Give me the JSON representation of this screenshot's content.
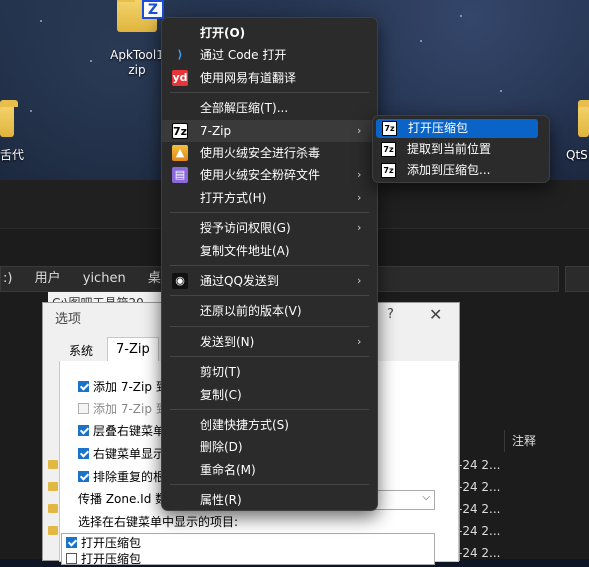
{
  "desktop": {
    "items": [
      {
        "label": "ApkTool1",
        "label2": "zip"
      },
      {
        "label": "舌代"
      },
      {
        "label": "QtS"
      }
    ]
  },
  "explorer": {
    "breadcrumb": [
      ":)",
      "用户",
      "yichen",
      "桌面"
    ],
    "window_title": "C:\\图吧工具箱20",
    "column_note": "注释",
    "dates": [
      "-24 2...",
      "-24 2...",
      "-24 2...",
      "-24 2...",
      "-24 2..."
    ]
  },
  "dialog": {
    "title": "选项",
    "help": "?",
    "close": "✕",
    "tabs": [
      {
        "label": "系统",
        "active": false
      },
      {
        "label": "7-Zip",
        "active": true
      }
    ],
    "options": [
      {
        "label": "添加 7-Zip 到7",
        "checked": true,
        "disabled": false
      },
      {
        "label": "添加 7-Zip 到7",
        "checked": false,
        "disabled": true
      },
      {
        "label": "层叠右键菜单",
        "checked": true,
        "disabled": false
      },
      {
        "label": "右键菜单显示",
        "checked": true,
        "disabled": false
      },
      {
        "label": "排除重复的根",
        "checked": true,
        "disabled": false
      }
    ],
    "zone_label": "传播 Zone.Id 数据",
    "list_label": "选择在右键菜单中显示的项目:",
    "list_items": [
      {
        "label": "打开压缩包",
        "checked": true
      },
      {
        "label": "打开压缩包",
        "checked": false
      }
    ]
  },
  "context_menu": {
    "items": [
      {
        "label": "打开(O)",
        "bold": true,
        "icon": "",
        "arrow": false
      },
      {
        "label": "通过 Code 打开",
        "icon": "vscode-icon",
        "arrow": false
      },
      {
        "label": "使用网易有道翻译",
        "icon": "youdao-icon",
        "arrow": false
      },
      {
        "sep": true
      },
      {
        "label": "全部解压缩(T)...",
        "icon": "",
        "arrow": false
      },
      {
        "label": "7-Zip",
        "icon": "7zip-icon",
        "arrow": true,
        "highlight": true
      },
      {
        "label": "使用火绒安全进行杀毒",
        "icon": "shield-icon",
        "arrow": false
      },
      {
        "label": "使用火绒安全粉碎文件",
        "icon": "shredder-icon",
        "arrow": true
      },
      {
        "label": "打开方式(H)",
        "icon": "",
        "arrow": true
      },
      {
        "sep": true
      },
      {
        "label": "授予访问权限(G)",
        "icon": "",
        "arrow": true
      },
      {
        "label": "复制文件地址(A)",
        "icon": "",
        "arrow": false
      },
      {
        "sep": true
      },
      {
        "label": "通过QQ发送到",
        "icon": "qq-icon",
        "arrow": true
      },
      {
        "sep": true
      },
      {
        "label": "还原以前的版本(V)",
        "icon": "",
        "arrow": false
      },
      {
        "sep": true
      },
      {
        "label": "发送到(N)",
        "icon": "",
        "arrow": true
      },
      {
        "sep": true
      },
      {
        "label": "剪切(T)",
        "icon": "",
        "arrow": false
      },
      {
        "label": "复制(C)",
        "icon": "",
        "arrow": false
      },
      {
        "sep": true
      },
      {
        "label": "创建快捷方式(S)",
        "icon": "",
        "arrow": false
      },
      {
        "label": "删除(D)",
        "icon": "",
        "arrow": false
      },
      {
        "label": "重命名(M)",
        "icon": "",
        "arrow": false
      },
      {
        "sep": true
      },
      {
        "label": "属性(R)",
        "icon": "",
        "arrow": false
      }
    ],
    "arrow_glyph": "›",
    "icon_text": {
      "7zip": "7z",
      "youdao": "yd",
      "vscode": "⟩",
      "shield": "▲",
      "shredder": "▤",
      "qq": "◉"
    }
  },
  "submenu_7zip": {
    "items": [
      {
        "label": "打开压缩包",
        "highlight": true
      },
      {
        "label": "提取到当前位置",
        "highlight": false
      },
      {
        "label": "添加到压缩包...",
        "highlight": false
      }
    ]
  },
  "colors": {
    "menu_bg": "#2b2b2b",
    "highlight_blue": "#0a64c8",
    "checkbox_blue": "#1a73c9"
  }
}
